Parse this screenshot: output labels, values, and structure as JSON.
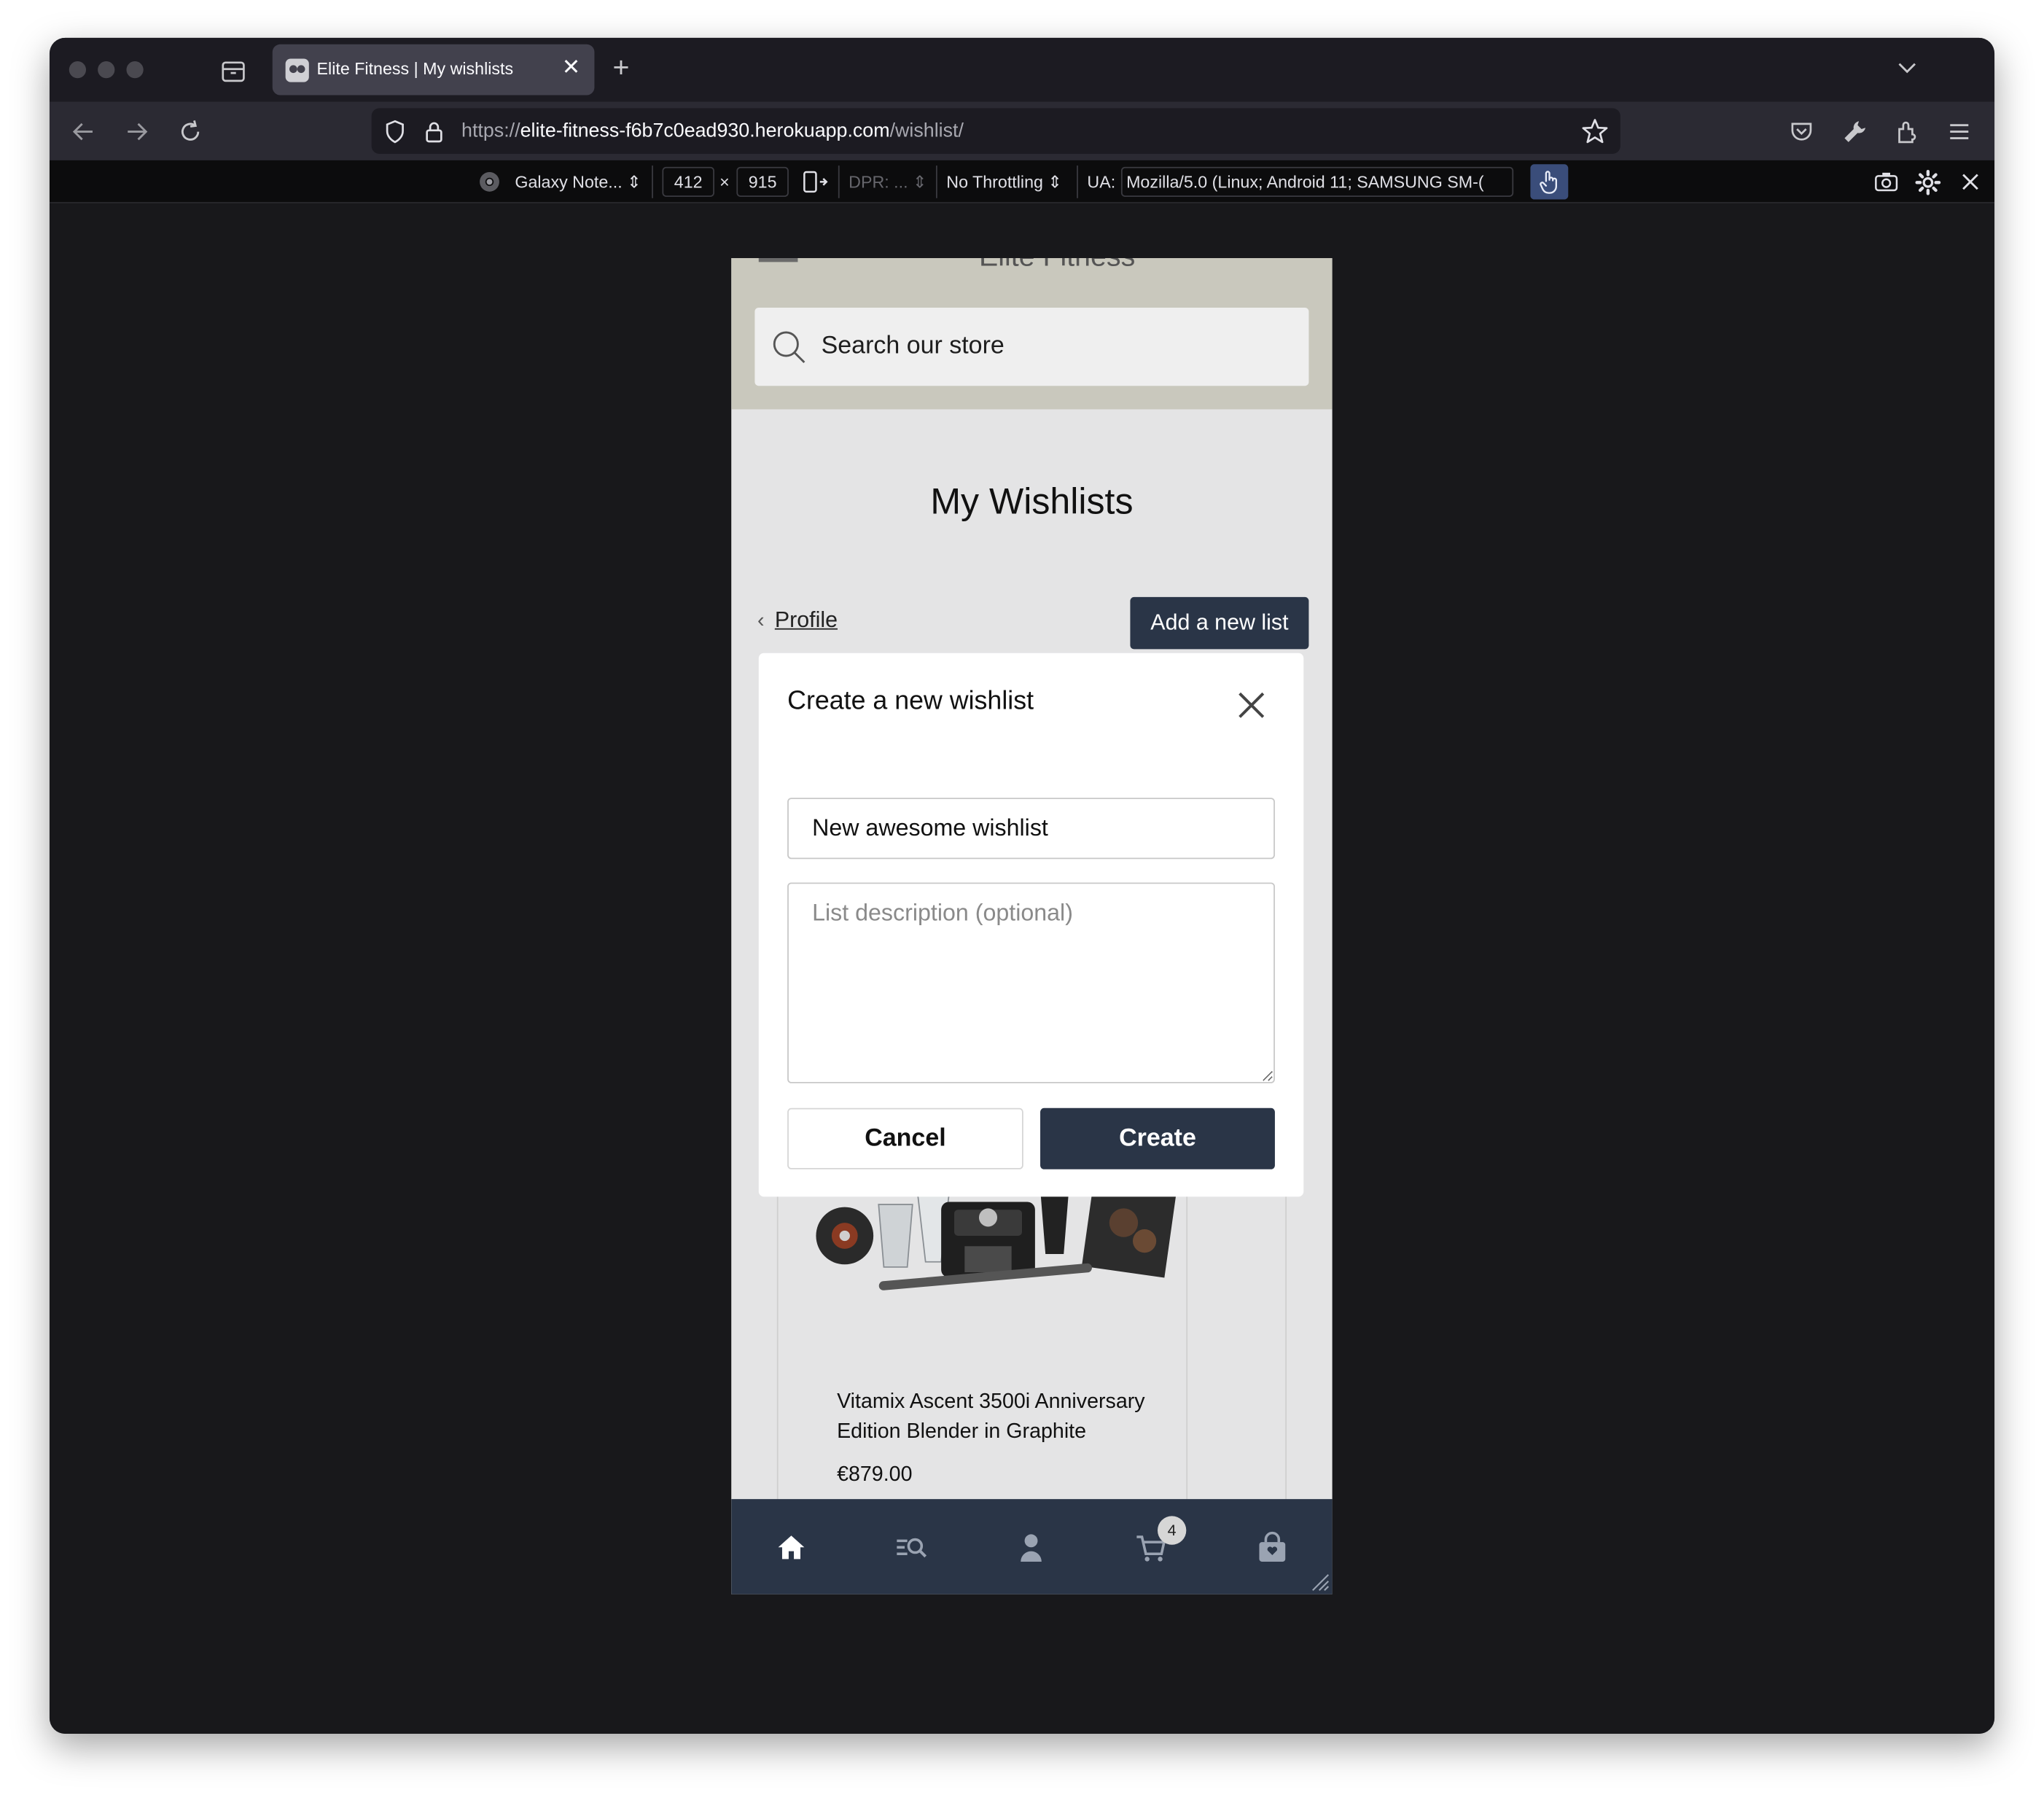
{
  "browser": {
    "tab_title": "Elite Fitness | My wishlists",
    "url_scheme": "https://",
    "url_host": "elite-fitness-f6b7c0ead930.herokuapp.com",
    "url_path": "/wishlist/"
  },
  "rdm": {
    "device": "Galaxy Note...",
    "width": "412",
    "times": "×",
    "height": "915",
    "dpr": "DPR: ...",
    "throttling": "No Throttling",
    "ua_label": "UA:",
    "ua_value": "Mozilla/5.0 (Linux; Android 11; SAMSUNG SM-("
  },
  "store": {
    "header_title_peek": "Elite Fitness",
    "search_placeholder": "Search our store",
    "page_title": "My Wishlists",
    "back_link": "Profile",
    "add_list_button": "Add a new list"
  },
  "modal": {
    "title": "Create a new wishlist",
    "name_value": "New awesome wishlist",
    "description_placeholder": "List description (optional)",
    "cancel_label": "Cancel",
    "create_label": "Create"
  },
  "product": {
    "name": "Vitamix Ascent 3500i Anniversary Edition Blender in Graphite",
    "price": "€879.00"
  },
  "bottom_nav": {
    "cart_count": "4",
    "items": [
      "home-icon",
      "search-list-icon",
      "user-icon",
      "cart-icon",
      "bag-icon"
    ]
  },
  "colors": {
    "brand_dark": "#2a3547",
    "header_bg": "#c9c8bd"
  }
}
